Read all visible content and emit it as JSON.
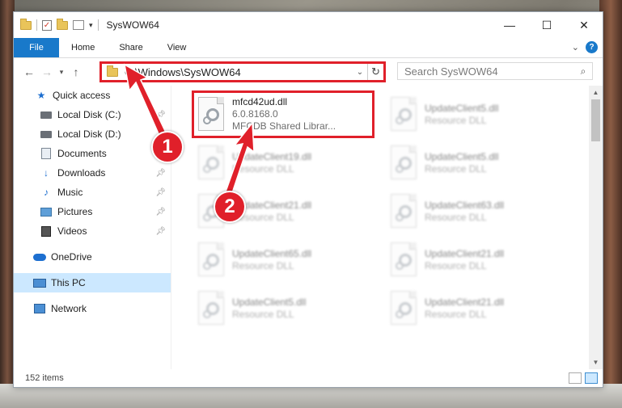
{
  "window": {
    "title": "SysWOW64",
    "controls": {
      "minimize": "—",
      "maximize": "☐",
      "close": "✕"
    }
  },
  "ribbon": {
    "tabs": [
      "File",
      "Home",
      "Share",
      "View"
    ],
    "help": "?"
  },
  "address_bar": {
    "path": "C:\\Windows\\SysWOW64"
  },
  "search": {
    "placeholder": "Search SysWOW64"
  },
  "sidebar": {
    "items": [
      {
        "label": "Quick access",
        "icon": "star-icon",
        "pinned": false
      },
      {
        "label": "Local Disk (C:)",
        "icon": "disk-icon",
        "pinned": true
      },
      {
        "label": "Local Disk (D:)",
        "icon": "disk-icon",
        "pinned": false
      },
      {
        "label": "Documents",
        "icon": "documents-icon",
        "pinned": true
      },
      {
        "label": "Downloads",
        "icon": "download-icon",
        "pinned": true
      },
      {
        "label": "Music",
        "icon": "music-icon",
        "pinned": true
      },
      {
        "label": "Pictures",
        "icon": "pictures-icon",
        "pinned": true
      },
      {
        "label": "Videos",
        "icon": "videos-icon",
        "pinned": true
      },
      {
        "label": "OneDrive",
        "icon": "cloud-icon",
        "pinned": false
      },
      {
        "label": "This PC",
        "icon": "pc-icon",
        "pinned": false,
        "selected": true
      },
      {
        "label": "Network",
        "icon": "network-icon",
        "pinned": false
      }
    ]
  },
  "files": {
    "highlighted": {
      "name": "mfcd42ud.dll",
      "version": "6.0.8168.0",
      "description": "MFCDB Shared Librar..."
    },
    "blurred": [
      {
        "name": "UpdateClient5.dll",
        "type": "Resource DLL"
      },
      {
        "name": "UpdateClient19.dll",
        "type": "Resource DLL"
      },
      {
        "name": "UpdateClient5.dll",
        "type": "Resource DLL"
      },
      {
        "name": "UpdateClient21.dll",
        "type": "Resource DLL"
      },
      {
        "name": "UpdateClient63.dll",
        "type": "Resource DLL"
      },
      {
        "name": "UpdateClient65.dll",
        "type": "Resource DLL"
      },
      {
        "name": "UpdateClient21.dll",
        "type": "Resource DLL"
      },
      {
        "name": "UpdateClient5.dll",
        "type": "Resource DLL"
      },
      {
        "name": "UpdateClient21.dll",
        "type": "Resource DLL"
      }
    ]
  },
  "status": {
    "item_count": "152 items"
  },
  "annotations": {
    "step1": "1",
    "step2": "2",
    "color": "#e0202a"
  }
}
